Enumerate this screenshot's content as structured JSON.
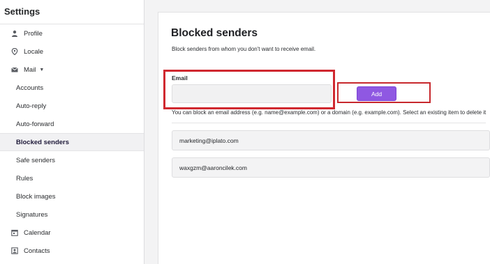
{
  "sidebar": {
    "title": "Settings",
    "items": [
      {
        "label": "Profile",
        "icon": "person-icon"
      },
      {
        "label": "Locale",
        "icon": "location-pin-icon"
      },
      {
        "label": "Mail",
        "icon": "mail-icon"
      },
      {
        "label": "Accounts"
      },
      {
        "label": "Auto-reply"
      },
      {
        "label": "Auto-forward"
      },
      {
        "label": "Blocked senders"
      },
      {
        "label": "Safe senders"
      },
      {
        "label": "Rules"
      },
      {
        "label": "Block images"
      },
      {
        "label": "Signatures"
      },
      {
        "label": "Calendar",
        "icon": "calendar-icon"
      },
      {
        "label": "Contacts",
        "icon": "contacts-icon"
      }
    ],
    "active_item": "Blocked senders"
  },
  "main": {
    "title": "Blocked senders",
    "description": "Block senders from whom you don't want to receive email.",
    "email_label": "Email",
    "email_value": "",
    "add_button_label": "Add",
    "helper_text": "You can block an email address (e.g. name@example.com) or a domain (e.g. example.com). Select an existing item to delete it",
    "blocked_list": [
      "marketing@iplato.com",
      "waxgzm@aaroncilek.com"
    ]
  },
  "colors": {
    "accent": "#8f58e2",
    "highlight_annotation": "#d0282f",
    "active_nav_text": "#1f1a3a"
  }
}
